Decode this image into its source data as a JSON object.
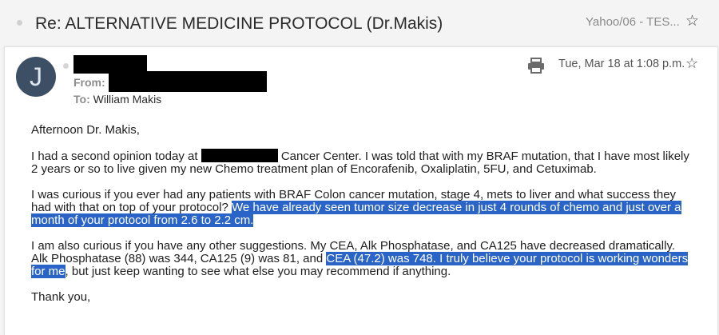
{
  "header": {
    "subject": "Re: ALTERNATIVE MEDICINE PROTOCOL (Dr.Makis)",
    "folder": "Yahoo/06 - TES...",
    "star_icon": "star-outline"
  },
  "message": {
    "avatar_letter": "J",
    "from_label": "From:",
    "to_label": "To:",
    "to_name": "William Makis",
    "date": "Tue, Mar 18 at 1:08 p.m."
  },
  "body": {
    "greeting": "Afternoon Dr. Makis,",
    "p1_a": "I had a second opinion today at",
    "p1_b": " Cancer Center. I was told that with my BRAF mutation, that I have most likely 2 years or so to live given my new Chemo treatment plan of Encorafenib, Oxaliplatin, 5FU, and Cetuximab.",
    "p2_a": "I was curious if you ever had any patients with BRAF Colon cancer mutation, stage 4, mets to liver and what success they had with that on top of your protocol? ",
    "p2_hl": "We have already seen tumor size decrease in just 4 rounds of chemo and just over a month of your protocol from 2.6 to 2.2 cm.",
    "p3_a": "I am also curious if you have any other suggestions. My CEA, Alk Phosphatase, and CA125 have decreased dramatically. Alk Phosphatase (88) was 344, CA125 (9) was 81, and ",
    "p3_hl": "CEA (47.2) was 748. I truly believe your protocol is working wonders for me",
    "p3_b": ", but just keep wanting to see what else you may recommend if anything.",
    "closing": "Thank you,"
  },
  "colors": {
    "highlight": "#2b64c7",
    "avatar_bg": "#3c4f65"
  }
}
